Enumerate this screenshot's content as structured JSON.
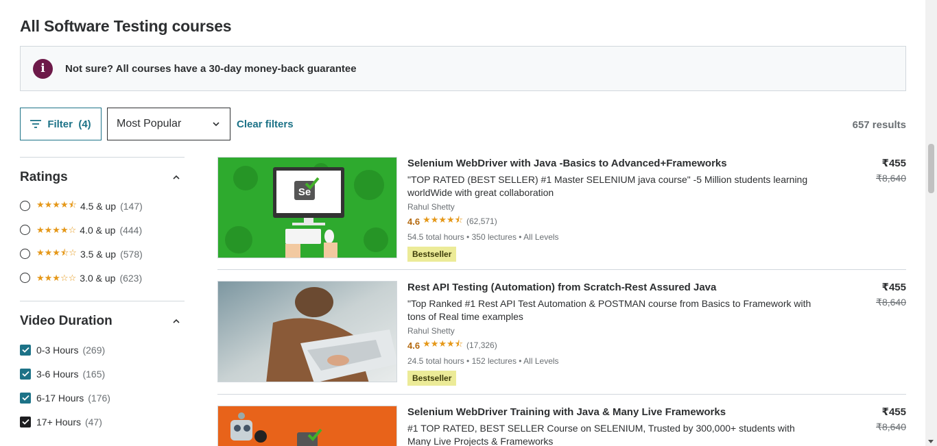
{
  "page": {
    "title": "All Software Testing courses"
  },
  "guarantee": {
    "icon": "info-icon",
    "glyph": "i",
    "text": "Not sure? All courses have a 30-day money-back guarantee"
  },
  "toolbar": {
    "filter_label": "Filter",
    "filter_count": "(4)",
    "sort_value": "Most Popular",
    "clear_label": "Clear filters",
    "results": "657 results"
  },
  "sidebar": {
    "ratings": {
      "title": "Ratings",
      "items": [
        {
          "stars": "★★★★⯪",
          "label": "4.5 & up",
          "count": "(147)"
        },
        {
          "stars": "★★★★☆",
          "label": "4.0 & up",
          "count": "(444)"
        },
        {
          "stars": "★★★⯪☆",
          "label": "3.5 & up",
          "count": "(578)"
        },
        {
          "stars": "★★★☆☆",
          "label": "3.0 & up",
          "count": "(623)"
        }
      ]
    },
    "duration": {
      "title": "Video Duration",
      "items": [
        {
          "label": "0-3 Hours",
          "count": "(269)",
          "checked": true
        },
        {
          "label": "3-6 Hours",
          "count": "(165)",
          "checked": true
        },
        {
          "label": "6-17 Hours",
          "count": "(176)",
          "checked": true
        },
        {
          "label": "17+ Hours",
          "count": "(47)",
          "checked": true
        }
      ]
    }
  },
  "courses": [
    {
      "title": "Selenium WebDriver with Java -Basics to Advanced+Frameworks",
      "description": "\"TOP RATED (BEST SELLER) #1 Master SELENIUM java course\" -5 Million students learning worldWide with great collaboration",
      "author": "Rahul Shetty",
      "rating": "4.6",
      "stars": "★★★★⯪",
      "reviews": "(62,571)",
      "meta": "54.5 total hours • 350 lectures • All Levels",
      "badge": "Bestseller",
      "price": "₹455",
      "old_price": "₹8,640",
      "thumb_color": "#2eaa2e"
    },
    {
      "title": "Rest API Testing (Automation) from Scratch-Rest Assured Java",
      "description": "\"Top Ranked #1 Rest API Test Automation & POSTMAN course from Basics to Framework with tons of Real time examples",
      "author": "Rahul Shetty",
      "rating": "4.6",
      "stars": "★★★★⯪",
      "reviews": "(17,326)",
      "meta": "24.5 total hours • 152 lectures • All Levels",
      "badge": "Bestseller",
      "price": "₹455",
      "old_price": "₹8,640",
      "thumb_color": "#a9b7bd"
    },
    {
      "title": "Selenium WebDriver Training with Java & Many Live Frameworks",
      "description": "#1 TOP RATED, BEST SELLER Course on SELENIUM, Trusted by 300,000+ students with Many Live Projects & Frameworks",
      "price": "₹455",
      "old_price": "₹8,640",
      "thumb_color": "#e8631a"
    }
  ],
  "colors": {
    "accent": "#1c7287",
    "star": "#e59819",
    "rating_text": "#b4690e",
    "badge_bg": "#eceb98"
  }
}
